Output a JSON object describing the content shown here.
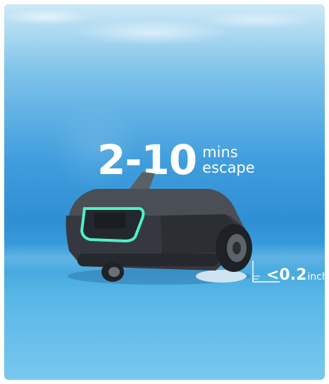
{
  "headline": {
    "number": "2-10",
    "unit_top": "mins",
    "unit_bottom": "escape"
  },
  "clearance": {
    "value": "<0.2",
    "unit": "inch"
  },
  "colors": {
    "water": "#2f8fd3",
    "robot_body": "#3b3f45",
    "accent_light": "#4ff0c8",
    "text": "#ffffff"
  }
}
